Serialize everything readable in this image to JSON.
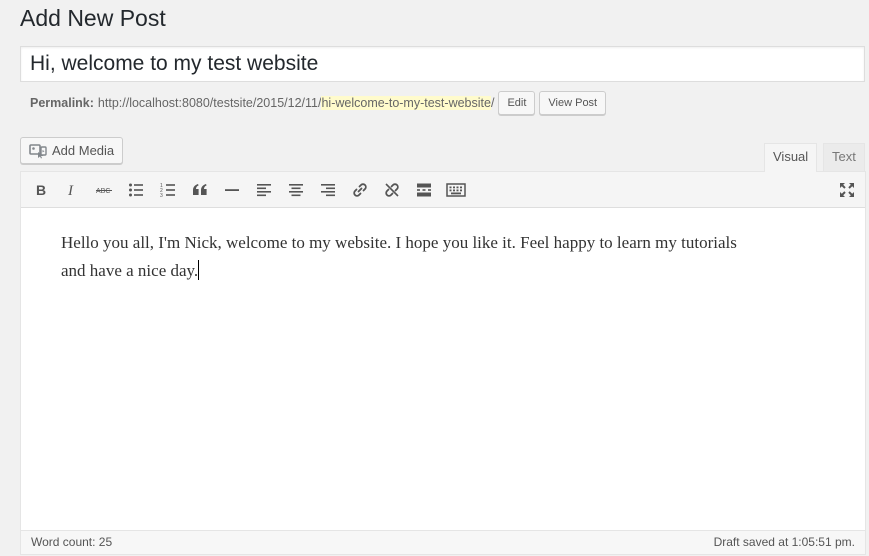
{
  "page": {
    "title": "Add New Post"
  },
  "post": {
    "title_value": "Hi, welcome to my test website",
    "content": "Hello you all, I'm Nick, welcome to my website. I hope you like it. Feel happy to learn my tutorials and have a nice day."
  },
  "permalink": {
    "label": "Permalink:",
    "base": "http://localhost:8080/testsite/2015/12/11/",
    "slug": "hi-welcome-to-my-test-website",
    "trailing": "/",
    "edit_label": "Edit",
    "view_label": "View Post"
  },
  "media": {
    "add_label": "Add Media"
  },
  "tabs": {
    "visual": "Visual",
    "text": "Text",
    "active": "visual"
  },
  "toolbar": {
    "buttons": [
      "bold-icon",
      "italic-icon",
      "strikethrough-icon",
      "bulleted-list-icon",
      "numbered-list-icon",
      "blockquote-icon",
      "horizontal-line-icon",
      "align-left-icon",
      "align-center-icon",
      "align-right-icon",
      "insert-link-icon",
      "remove-link-icon",
      "read-more-icon",
      "toolbar-toggle-icon",
      "fullscreen-icon"
    ]
  },
  "status": {
    "word_count": "Word count: 25",
    "draft_saved": "Draft saved at 1:05:51 pm."
  },
  "colors": {
    "background": "#f1f1f1",
    "slug_highlight": "#fffbcc",
    "editor_text": "#333333"
  }
}
